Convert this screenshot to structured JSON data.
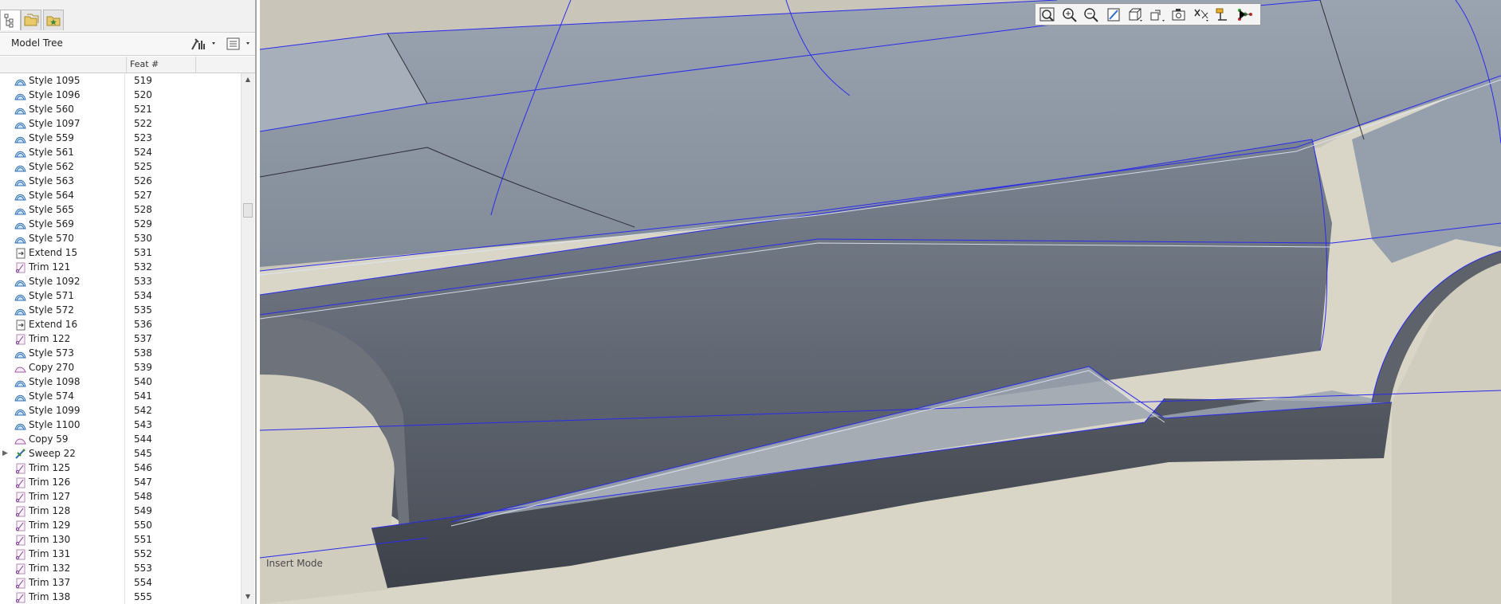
{
  "model_tree": {
    "title": "Model Tree",
    "columns": {
      "feat": "Feat #"
    },
    "rows": [
      {
        "name": "Style 1095",
        "feat": "519",
        "icon": "style-surface-icon"
      },
      {
        "name": "Style 1096",
        "feat": "520",
        "icon": "style-surface-icon"
      },
      {
        "name": "Style 560",
        "feat": "521",
        "icon": "style-surface-icon"
      },
      {
        "name": "Style 1097",
        "feat": "522",
        "icon": "style-surface-icon"
      },
      {
        "name": "Style 559",
        "feat": "523",
        "icon": "style-surface-icon"
      },
      {
        "name": "Style 561",
        "feat": "524",
        "icon": "style-surface-icon"
      },
      {
        "name": "Style 562",
        "feat": "525",
        "icon": "style-surface-icon"
      },
      {
        "name": "Style 563",
        "feat": "526",
        "icon": "style-surface-icon"
      },
      {
        "name": "Style 564",
        "feat": "527",
        "icon": "style-surface-icon"
      },
      {
        "name": "Style 565",
        "feat": "528",
        "icon": "style-surface-icon"
      },
      {
        "name": "Style 569",
        "feat": "529",
        "icon": "style-surface-icon"
      },
      {
        "name": "Style 570",
        "feat": "530",
        "icon": "style-surface-icon"
      },
      {
        "name": "Extend 15",
        "feat": "531",
        "icon": "extend-icon"
      },
      {
        "name": "Trim 121",
        "feat": "532",
        "icon": "trim-icon"
      },
      {
        "name": "Style 1092",
        "feat": "533",
        "icon": "style-surface-icon"
      },
      {
        "name": "Style 571",
        "feat": "534",
        "icon": "style-surface-icon"
      },
      {
        "name": "Style 572",
        "feat": "535",
        "icon": "style-surface-icon"
      },
      {
        "name": "Extend 16",
        "feat": "536",
        "icon": "extend-icon"
      },
      {
        "name": "Trim 122",
        "feat": "537",
        "icon": "trim-icon"
      },
      {
        "name": "Style 573",
        "feat": "538",
        "icon": "style-surface-icon"
      },
      {
        "name": "Copy 270",
        "feat": "539",
        "icon": "copy-icon"
      },
      {
        "name": "Style 1098",
        "feat": "540",
        "icon": "style-surface-icon"
      },
      {
        "name": "Style 574",
        "feat": "541",
        "icon": "style-surface-icon"
      },
      {
        "name": "Style 1099",
        "feat": "542",
        "icon": "style-surface-icon"
      },
      {
        "name": "Style 1100",
        "feat": "543",
        "icon": "style-surface-icon"
      },
      {
        "name": "Copy 59",
        "feat": "544",
        "icon": "copy-icon"
      },
      {
        "name": "Sweep 22",
        "feat": "545",
        "icon": "sweep-icon",
        "expandable": true
      },
      {
        "name": "Trim 125",
        "feat": "546",
        "icon": "trim-icon"
      },
      {
        "name": "Trim 126",
        "feat": "547",
        "icon": "trim-icon"
      },
      {
        "name": "Trim 127",
        "feat": "548",
        "icon": "trim-icon"
      },
      {
        "name": "Trim 128",
        "feat": "549",
        "icon": "trim-icon"
      },
      {
        "name": "Trim 129",
        "feat": "550",
        "icon": "trim-icon"
      },
      {
        "name": "Trim 130",
        "feat": "551",
        "icon": "trim-icon"
      },
      {
        "name": "Trim 131",
        "feat": "552",
        "icon": "trim-icon"
      },
      {
        "name": "Trim 132",
        "feat": "553",
        "icon": "trim-icon"
      },
      {
        "name": "Trim 137",
        "feat": "554",
        "icon": "trim-icon"
      },
      {
        "name": "Trim 138",
        "feat": "555",
        "icon": "trim-icon"
      }
    ]
  },
  "viewport": {
    "status_message": "Insert Mode",
    "toolbar": [
      "refit-icon",
      "zoom-in-icon",
      "zoom-out-icon",
      "repaint-icon",
      "display-style-icon",
      "named-views-icon",
      "saved-orientations-icon",
      "datum-display-icon",
      "annotation-display-icon",
      "spin-center-icon"
    ]
  },
  "colors": {
    "selection_edge": "#2a2aee",
    "surface": "#8c96a3",
    "background": "#d9d6c8"
  }
}
